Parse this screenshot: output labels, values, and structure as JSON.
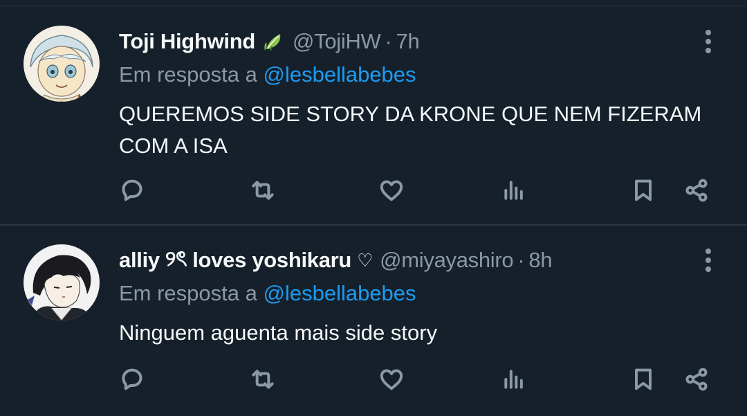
{
  "tweets": [
    {
      "display_name": "Toji Highwind",
      "handle": "@TojiHW",
      "separator": "·",
      "time": "7h",
      "reply_prefix": "Em resposta a ",
      "reply_to": "@lesbellabebes",
      "text": "QUEREMOS SIDE STORY DA KRONE QUE NEM FIZERAM COM A ISA",
      "badge_icon": "sprout-leaf-icon",
      "colors": {
        "badge": "#8bc34a"
      }
    },
    {
      "display_name": "alliy",
      "name_emoji": "୨ৎ",
      "display_name_rest": "loves yoshikaru",
      "name_heart": "♡",
      "handle": "@miyayashiro",
      "separator": "·",
      "time": "8h",
      "reply_prefix": "Em resposta a ",
      "reply_to": "@lesbellabebes",
      "text": "Ninguem aguenta mais side story"
    }
  ],
  "action_icons": [
    "reply-icon",
    "retweet-icon",
    "like-icon",
    "views-icon",
    "bookmark-icon",
    "share-icon"
  ],
  "colors": {
    "background": "#15202b",
    "text": "#f7f9f9",
    "muted": "#8b98a5",
    "link": "#1d9bf0",
    "divider": "#2a3642"
  }
}
